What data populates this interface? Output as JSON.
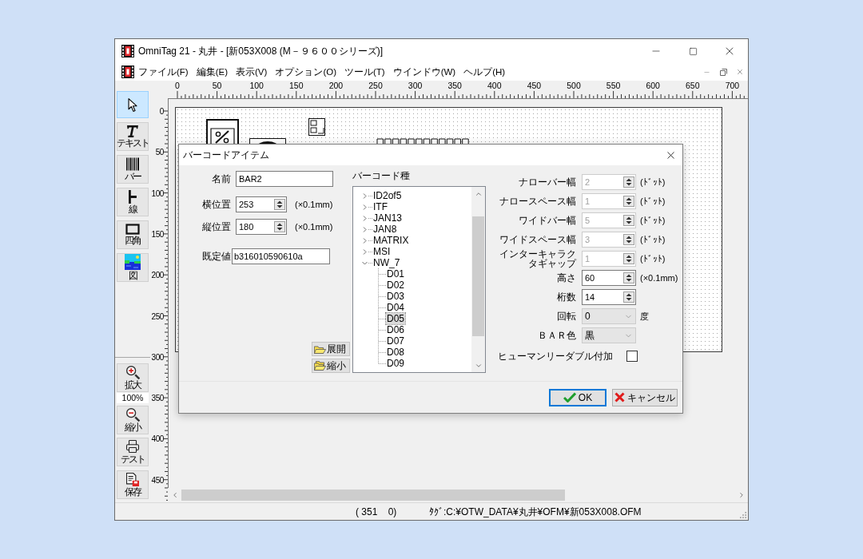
{
  "window": {
    "title": "OmniTag 21 - 丸井 - [新053X008 (M－９６００シリーズ)]"
  },
  "menu": [
    "ファイル(F)",
    "編集(E)",
    "表示(V)",
    "オプション(O)",
    "ツール(T)",
    "ウインドウ(W)",
    "ヘルプ(H)"
  ],
  "tools": [
    {
      "selected": true
    },
    {
      "label": "テキスト",
      "selected": false
    },
    {
      "label": "バー",
      "selected": false
    },
    {
      "label": "線",
      "selected": false
    },
    {
      "label": "四角",
      "selected": false
    },
    {
      "label": "図",
      "selected": false
    }
  ],
  "zoom": {
    "zoom_in": "拡大",
    "level": "100%",
    "zoom_out": "縮小"
  },
  "actions": [
    "テスト",
    "保存"
  ],
  "ruler": {
    "horizontal": [
      "0",
      "50",
      "100",
      "150",
      "200",
      "250",
      "300",
      "350",
      "400",
      "450",
      "500",
      "550",
      "600",
      "650",
      "700"
    ],
    "vertical": [
      "0",
      "50",
      "100",
      "150",
      "200",
      "250",
      "300",
      "350",
      "400",
      "450"
    ]
  },
  "dialog": {
    "title": "バーコードアイテム",
    "name": {
      "label": "名前",
      "value": "BAR2"
    },
    "x_position": {
      "label": "横位置",
      "value": "253",
      "unit": "(×0.1mm)"
    },
    "y_position": {
      "label": "縦位置",
      "value": "180",
      "unit": "(×0.1mm)"
    },
    "default_value": {
      "label": "既定値",
      "value": "b316010590610a"
    },
    "expand_all": "展開",
    "collapse_all": "縮小",
    "barcode_type": {
      "label": "バーコード種",
      "items": [
        {
          "label": "ID2of5",
          "expanded": false,
          "selected": false
        },
        {
          "label": "ITF",
          "expanded": false,
          "selected": false
        },
        {
          "label": "JAN13",
          "expanded": false,
          "selected": false
        },
        {
          "label": "JAN8",
          "expanded": false,
          "selected": false
        },
        {
          "label": "MATRIX",
          "expanded": false,
          "selected": false
        },
        {
          "label": "MSI",
          "expanded": false,
          "selected": false
        },
        {
          "label": "NW_7",
          "expanded": true,
          "selected": false,
          "children": [
            {
              "label": "D01",
              "selected": false
            },
            {
              "label": "D02",
              "selected": false
            },
            {
              "label": "D03",
              "selected": false
            },
            {
              "label": "D04",
              "selected": false
            },
            {
              "label": "D05",
              "selected": true
            },
            {
              "label": "D06",
              "selected": false
            },
            {
              "label": "D07",
              "selected": false
            },
            {
              "label": "D08",
              "selected": false
            },
            {
              "label": "D09",
              "selected": false
            }
          ]
        }
      ]
    },
    "settings": [
      {
        "label": "ナローバー幅",
        "kind": "spin",
        "value": "2",
        "disabled": true,
        "unit": "(ﾄﾞｯﾄ)"
      },
      {
        "label": "ナロースペース幅",
        "kind": "spin",
        "value": "1",
        "disabled": true,
        "unit": "(ﾄﾞｯﾄ)"
      },
      {
        "label": "ワイドバー幅",
        "kind": "spin",
        "value": "5",
        "disabled": true,
        "unit": "(ﾄﾞｯﾄ)"
      },
      {
        "label": "ワイドスペース幅",
        "kind": "spin",
        "value": "3",
        "disabled": true,
        "unit": "(ﾄﾞｯﾄ)"
      },
      {
        "label": "インターキャラクタギャップ",
        "kind": "spin",
        "value": "1",
        "disabled": true,
        "unit": "(ﾄﾞｯﾄ)"
      },
      {
        "label": "高さ",
        "kind": "spin",
        "value": "60",
        "disabled": false,
        "unit": "(×0.1mm)"
      },
      {
        "label": "桁数",
        "kind": "spin",
        "value": "14",
        "disabled": false
      },
      {
        "label": "回転",
        "kind": "select",
        "value": "0",
        "disabled": false,
        "unit": "度"
      },
      {
        "label": "ＢＡＲ色",
        "kind": "select",
        "value": "黒",
        "disabled": false
      }
    ],
    "human_readable": {
      "label": "ヒューマンリーダブル付加",
      "checked": false
    },
    "buttons": [
      {
        "label": "OK",
        "kind": "ok",
        "focused": true
      },
      {
        "label": "キャンセル",
        "kind": "cancel",
        "focused": false
      }
    ]
  },
  "status_bar": {
    "position": "( 351    0)",
    "file": "ﾀｸﾞ:C:¥OTW_DATA¥丸井¥OFM¥新053X008.OFM"
  }
}
